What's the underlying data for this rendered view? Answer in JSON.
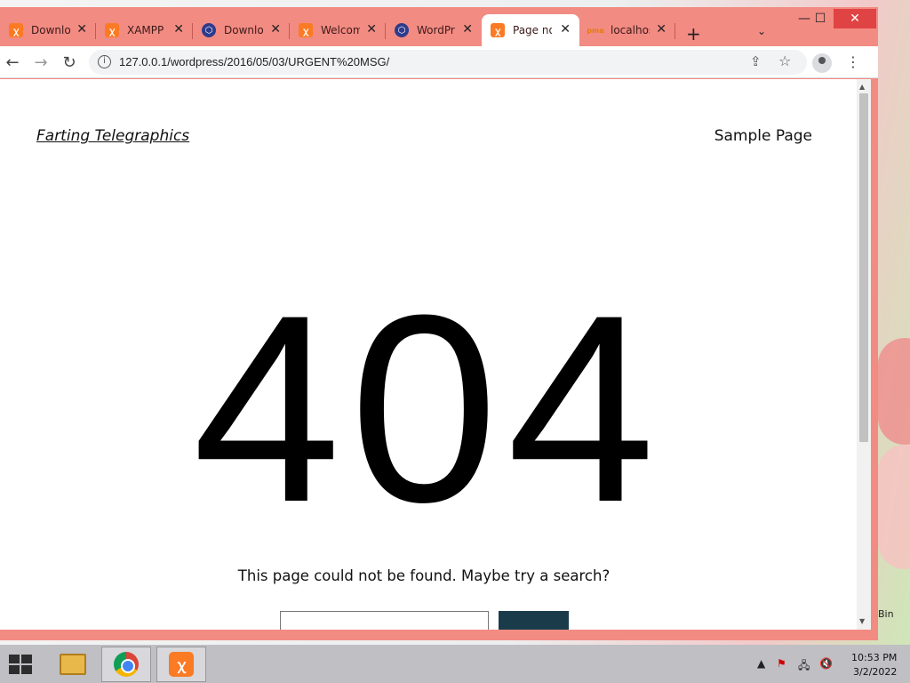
{
  "browser": {
    "tabs": [
      {
        "title": "Downlo",
        "favicon": "xampp-icon",
        "active": false
      },
      {
        "title": "XAMPP",
        "favicon": "xampp-icon",
        "active": false
      },
      {
        "title": "Downlo",
        "favicon": "wordpress-hex-icon",
        "active": false
      },
      {
        "title": "Welcom",
        "favicon": "xampp-icon",
        "active": false
      },
      {
        "title": "WordPr",
        "favicon": "wordpress-hex-icon",
        "active": false
      },
      {
        "title": "Page no",
        "favicon": "xampp-icon",
        "active": true
      },
      {
        "title": "localhos",
        "favicon": "phpmyadmin-icon",
        "active": false
      }
    ],
    "new_tab": "+",
    "tab_list": "⌄",
    "window_controls": {
      "minimize": "—",
      "maximize": "☐",
      "close": "✕"
    },
    "url": "127.0.0.1/wordpress/2016/05/03/URGENT%20MSG/",
    "frame_color": "#f28b82"
  },
  "page": {
    "site_title": "Farting Telegraphics",
    "nav_item": "Sample Page",
    "error_code": "404",
    "message": "This page could not be found. Maybe try a search?",
    "search_button_color": "#1a3c4a"
  },
  "desktop": {
    "recycle_bin_label": "Bin"
  },
  "taskbar": {
    "apps": [
      "file-explorer-icon",
      "chrome-icon",
      "xampp-icon"
    ],
    "clock_time": "10:53 PM",
    "clock_date": "3/2/2022"
  }
}
